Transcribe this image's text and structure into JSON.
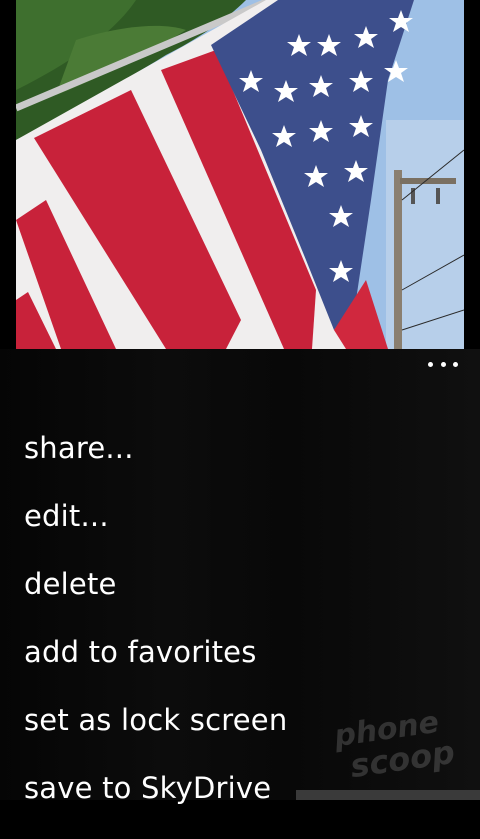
{
  "photo": {
    "subject": "american-flag-photo"
  },
  "appbar": {
    "more_icon": "ellipsis-icon",
    "menu_items": [
      "share...",
      "edit...",
      "delete",
      "add to favorites",
      "set as lock screen",
      "save to SkyDrive"
    ]
  },
  "watermark": {
    "line1": "phone",
    "line2": "scoop"
  },
  "colors": {
    "background": "#000000",
    "text": "#ffffff",
    "flag_red": "#c8223a",
    "flag_blue": "#3d4f8c",
    "flag_white": "#f2f2f2",
    "sky": "#8fb6e0"
  }
}
